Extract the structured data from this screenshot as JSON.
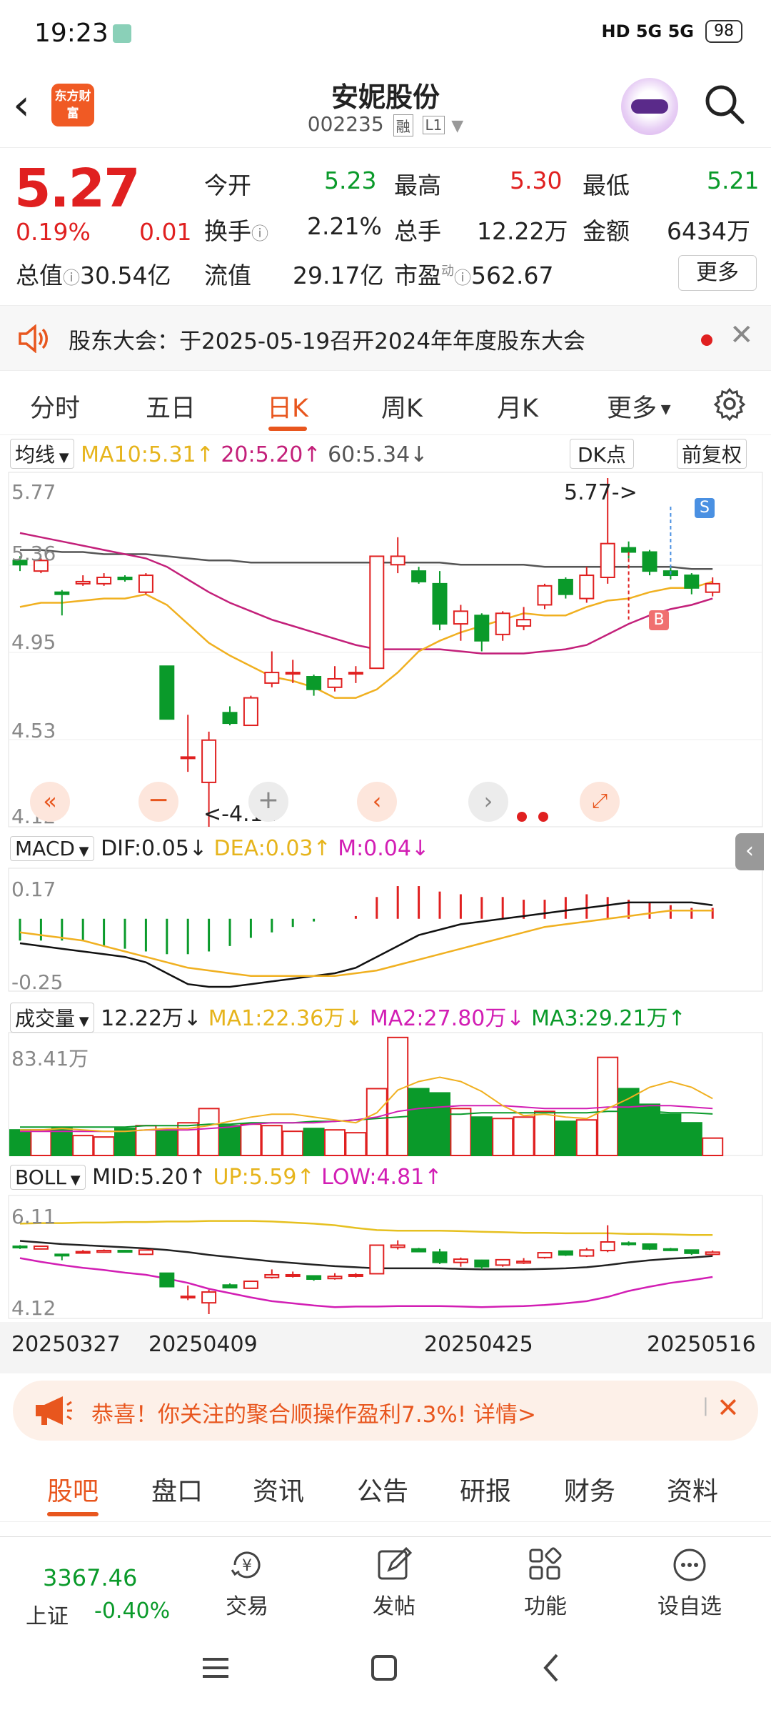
{
  "status_bar": {
    "time": "19:23",
    "network": "HD 5G 5G",
    "battery": "98"
  },
  "header": {
    "logo_text": "东方财富",
    "stock_name": "安妮股份",
    "stock_code": "002235",
    "tag1": "融",
    "tag2": "L1"
  },
  "quote": {
    "price": "5.27",
    "change_pct": "0.19%",
    "change_abs": "0.01",
    "open_label": "今开",
    "open": "5.23",
    "high_label": "最高",
    "high": "5.30",
    "low_label": "最低",
    "low": "5.21",
    "turnover_label": "换手",
    "turnover": "2.21%",
    "volume_label": "总手",
    "volume": "12.22万",
    "amount_label": "金额",
    "amount": "6434万",
    "mktcap_label": "总值",
    "mktcap": "30.54亿",
    "float_label": "流值",
    "float": "29.17亿",
    "pe_label": "市盈",
    "pe_sup": "动",
    "pe": "562.67",
    "more_label": "更多"
  },
  "notice": {
    "text": "股东大会：于2025-05-19召开2024年年度股东大会"
  },
  "chart_tabs": [
    "分时",
    "五日",
    "日K",
    "周K",
    "月K",
    "更多"
  ],
  "active_tab": "日K",
  "kline_bar": {
    "ma_select": "均线",
    "ma10": "MA10:5.31",
    "ma20": "20:5.20",
    "ma60": "60:5.34",
    "dk": "DK点",
    "fq": "前复权"
  },
  "macd_bar": {
    "select": "MACD",
    "dif": "DIF:0.05",
    "dea": "DEA:0.03",
    "m": "M:0.04"
  },
  "vol_bar": {
    "select": "成交量",
    "vol": "12.22万",
    "ma1": "MA1:22.36万",
    "ma2": "MA2:27.80万",
    "ma3": "MA3:29.21万"
  },
  "boll_bar": {
    "select": "BOLL",
    "mid": "MID:5.20",
    "up": "UP:5.59",
    "low": "LOW:4.81"
  },
  "axis_labels": {
    "k_top": "5.77",
    "k_2": "5.36",
    "k_3": "4.95",
    "k_4": "4.53",
    "k_bot": "4.12",
    "macd_top": "0.17",
    "macd_bot": "-0.25",
    "vol_top": "83.41万",
    "boll_top": "6.11",
    "boll_bot": "4.12",
    "dates": [
      "20250327",
      "20250409",
      "20250425",
      "20250516"
    ]
  },
  "annotations": {
    "max_marker": "5.77->",
    "min_marker": "<-4.12",
    "sell": "S",
    "buy": "B"
  },
  "chart_data": {
    "type": "candlestick",
    "start_date": "20250327",
    "end_date": "20250516",
    "candles": [
      {
        "o": 5.38,
        "c": 5.36,
        "h": 5.4,
        "l": 5.33
      },
      {
        "o": 5.33,
        "c": 5.38,
        "h": 5.39,
        "l": 5.32
      },
      {
        "o": 5.23,
        "c": 5.22,
        "h": 5.24,
        "l": 5.12
      },
      {
        "o": 5.27,
        "c": 5.28,
        "h": 5.31,
        "l": 5.26
      },
      {
        "o": 5.27,
        "c": 5.3,
        "h": 5.32,
        "l": 5.26
      },
      {
        "o": 5.3,
        "c": 5.29,
        "h": 5.31,
        "l": 5.28
      },
      {
        "o": 5.23,
        "c": 5.31,
        "h": 5.32,
        "l": 5.22
      },
      {
        "o": 4.88,
        "c": 4.63,
        "h": 4.88,
        "l": 4.63
      },
      {
        "o": 4.45,
        "c": 4.45,
        "h": 4.65,
        "l": 4.38
      },
      {
        "o": 4.33,
        "c": 4.53,
        "h": 4.57,
        "l": 4.12
      },
      {
        "o": 4.66,
        "c": 4.61,
        "h": 4.69,
        "l": 4.6
      },
      {
        "o": 4.6,
        "c": 4.73,
        "h": 4.74,
        "l": 4.6
      },
      {
        "o": 4.8,
        "c": 4.85,
        "h": 4.95,
        "l": 4.78
      },
      {
        "o": 4.85,
        "c": 4.85,
        "h": 4.91,
        "l": 4.8
      },
      {
        "o": 4.83,
        "c": 4.77,
        "h": 4.84,
        "l": 4.74
      },
      {
        "o": 4.78,
        "c": 4.82,
        "h": 4.88,
        "l": 4.76
      },
      {
        "o": 4.85,
        "c": 4.85,
        "h": 4.88,
        "l": 4.8
      },
      {
        "o": 4.87,
        "c": 5.4,
        "h": 5.4,
        "l": 4.87
      },
      {
        "o": 5.36,
        "c": 5.4,
        "h": 5.49,
        "l": 5.32
      },
      {
        "o": 5.33,
        "c": 5.28,
        "h": 5.35,
        "l": 5.27
      },
      {
        "o": 5.27,
        "c": 5.08,
        "h": 5.33,
        "l": 5.05
      },
      {
        "o": 5.08,
        "c": 5.14,
        "h": 5.17,
        "l": 5.0
      },
      {
        "o": 5.12,
        "c": 5.0,
        "h": 5.13,
        "l": 4.95
      },
      {
        "o": 5.03,
        "c": 5.13,
        "h": 5.14,
        "l": 5.0
      },
      {
        "o": 5.07,
        "c": 5.1,
        "h": 5.16,
        "l": 5.05
      },
      {
        "o": 5.17,
        "c": 5.26,
        "h": 5.27,
        "l": 5.15
      },
      {
        "o": 5.29,
        "c": 5.22,
        "h": 5.3,
        "l": 5.2
      },
      {
        "o": 5.2,
        "c": 5.31,
        "h": 5.35,
        "l": 5.18
      },
      {
        "o": 5.3,
        "c": 5.46,
        "h": 5.77,
        "l": 5.27
      },
      {
        "o": 5.44,
        "c": 5.42,
        "h": 5.47,
        "l": 5.39
      },
      {
        "o": 5.42,
        "c": 5.33,
        "h": 5.43,
        "l": 5.31
      },
      {
        "o": 5.33,
        "c": 5.31,
        "h": 5.35,
        "l": 5.29
      },
      {
        "o": 5.31,
        "c": 5.25,
        "h": 5.32,
        "l": 5.22
      },
      {
        "o": 5.23,
        "c": 5.27,
        "h": 5.3,
        "l": 5.21
      }
    ],
    "ma10": [
      5.16,
      5.18,
      5.18,
      5.19,
      5.2,
      5.2,
      5.22,
      5.17,
      5.08,
      4.99,
      4.93,
      4.88,
      4.83,
      4.81,
      4.78,
      4.73,
      4.73,
      4.77,
      4.85,
      4.95,
      5.0,
      5.04,
      5.07,
      5.1,
      5.13,
      5.12,
      5.12,
      5.16,
      5.19,
      5.2,
      5.23,
      5.25,
      5.25,
      5.28
    ],
    "ma20": [
      5.51,
      5.49,
      5.47,
      5.45,
      5.43,
      5.41,
      5.39,
      5.35,
      5.29,
      5.23,
      5.18,
      5.14,
      5.1,
      5.07,
      5.04,
      5.01,
      4.98,
      4.96,
      4.96,
      4.96,
      4.96,
      4.95,
      4.94,
      4.94,
      4.94,
      4.95,
      4.96,
      4.98,
      5.03,
      5.08,
      5.12,
      5.15,
      5.17,
      5.2
    ],
    "ma60": [
      5.43,
      5.43,
      5.42,
      5.42,
      5.41,
      5.41,
      5.41,
      5.4,
      5.39,
      5.38,
      5.38,
      5.37,
      5.37,
      5.37,
      5.37,
      5.37,
      5.37,
      5.37,
      5.37,
      5.37,
      5.37,
      5.36,
      5.36,
      5.36,
      5.36,
      5.35,
      5.35,
      5.35,
      5.35,
      5.35,
      5.35,
      5.35,
      5.34,
      5.34
    ],
    "macd_dif": [
      -0.09,
      -0.1,
      -0.11,
      -0.12,
      -0.13,
      -0.14,
      -0.16,
      -0.2,
      -0.24,
      -0.25,
      -0.25,
      -0.24,
      -0.23,
      -0.22,
      -0.21,
      -0.2,
      -0.18,
      -0.14,
      -0.1,
      -0.06,
      -0.04,
      -0.02,
      -0.01,
      0.0,
      0.01,
      0.02,
      0.03,
      0.04,
      0.05,
      0.06,
      0.06,
      0.06,
      0.06,
      0.05
    ],
    "macd_dea": [
      -0.05,
      -0.06,
      -0.07,
      -0.08,
      -0.1,
      -0.12,
      -0.14,
      -0.16,
      -0.18,
      -0.19,
      -0.2,
      -0.21,
      -0.21,
      -0.21,
      -0.21,
      -0.21,
      -0.2,
      -0.19,
      -0.17,
      -0.15,
      -0.13,
      -0.11,
      -0.09,
      -0.07,
      -0.05,
      -0.03,
      -0.02,
      -0.01,
      0.0,
      0.01,
      0.02,
      0.03,
      0.03,
      0.03
    ],
    "macd_m": [
      -0.08,
      -0.08,
      -0.08,
      -0.08,
      -0.1,
      -0.11,
      -0.12,
      -0.13,
      -0.13,
      -0.12,
      -0.1,
      -0.07,
      -0.05,
      -0.03,
      -0.01,
      0.0,
      0.01,
      0.08,
      0.12,
      0.12,
      0.1,
      0.09,
      0.08,
      0.08,
      0.07,
      0.07,
      0.08,
      0.09,
      0.08,
      0.07,
      0.06,
      0.05,
      0.04,
      0.04
    ],
    "volume_wan": [
      18,
      18,
      19,
      14,
      13,
      19,
      21,
      18,
      23,
      33,
      21,
      22,
      21,
      17,
      19,
      18,
      16,
      47,
      83,
      47,
      44,
      33,
      27,
      26,
      27,
      31,
      24,
      25,
      69,
      47,
      36,
      29,
      23,
      12.22
    ],
    "vol_ma1": [
      18,
      18,
      19,
      18,
      17,
      17,
      18,
      19,
      19,
      21,
      24,
      27,
      29,
      29,
      27,
      25,
      23,
      30,
      46,
      52,
      55,
      52,
      45,
      35,
      28,
      29,
      27,
      26,
      33,
      40,
      48,
      52,
      48,
      40
    ],
    "vol_ma2": [
      17,
      17,
      17,
      17,
      17,
      17,
      18,
      18,
      18,
      19,
      20,
      22,
      23,
      23,
      23,
      24,
      25,
      27,
      31,
      33,
      34,
      35,
      35,
      35,
      34,
      33,
      33,
      33,
      34,
      34,
      35,
      35,
      34,
      33
    ],
    "vol_ma3": [
      20,
      20,
      20,
      20,
      20,
      20,
      21,
      21,
      21,
      22,
      22,
      23,
      23,
      23,
      24,
      24,
      25,
      26,
      27,
      28,
      29,
      29,
      30,
      30,
      30,
      30,
      30,
      30,
      31,
      31,
      31,
      30,
      30,
      29.21
    ],
    "boll_up": [
      5.8,
      5.81,
      5.81,
      5.82,
      5.82,
      5.83,
      5.83,
      5.84,
      5.84,
      5.85,
      5.85,
      5.85,
      5.84,
      5.82,
      5.8,
      5.77,
      5.72,
      5.68,
      5.67,
      5.67,
      5.67,
      5.66,
      5.65,
      5.64,
      5.63,
      5.63,
      5.62,
      5.62,
      5.62,
      5.61,
      5.61,
      5.6,
      5.59,
      5.59
    ],
    "boll_mid": [
      5.48,
      5.45,
      5.42,
      5.4,
      5.38,
      5.36,
      5.34,
      5.31,
      5.27,
      5.22,
      5.18,
      5.14,
      5.1,
      5.07,
      5.04,
      5.01,
      4.99,
      4.97,
      4.97,
      4.97,
      4.97,
      4.96,
      4.95,
      4.95,
      4.95,
      4.96,
      4.97,
      4.99,
      5.03,
      5.08,
      5.12,
      5.15,
      5.17,
      5.2
    ],
    "boll_low": [
      5.16,
      5.09,
      5.03,
      4.98,
      4.94,
      4.89,
      4.85,
      4.78,
      4.7,
      4.59,
      4.51,
      4.43,
      4.36,
      4.32,
      4.28,
      4.25,
      4.26,
      4.26,
      4.27,
      4.27,
      4.27,
      4.26,
      4.25,
      4.26,
      4.27,
      4.29,
      4.32,
      4.36,
      4.44,
      4.55,
      4.63,
      4.7,
      4.75,
      4.81
    ],
    "k_ylim": [
      4.12,
      5.77
    ],
    "macd_ylim": [
      -0.25,
      0.17
    ],
    "vol_ylim": [
      0,
      83.41
    ],
    "boll_ylim": [
      4.12,
      6.11
    ],
    "colors": {
      "up": "#e02020",
      "down": "#0a9a2a",
      "ma10": "#f0b020",
      "ma20": "#c3207a",
      "ma60": "#555555",
      "dif": "#111111",
      "dea": "#f0b020",
      "ma2": "#d21eb4",
      "ma3": "#0a9a2a"
    }
  },
  "banner": {
    "text": "恭喜！你关注的聚合顺操作盈利7.3%! 详情>"
  },
  "bottom_tabs": [
    "股吧",
    "盘口",
    "资讯",
    "公告",
    "研报",
    "财务",
    "资料"
  ],
  "footer": {
    "index_value": "3367.46",
    "index_name": "上证",
    "index_change": "-0.40%",
    "trade": "交易",
    "post": "发帖",
    "func": "功能",
    "watch": "设自选"
  }
}
